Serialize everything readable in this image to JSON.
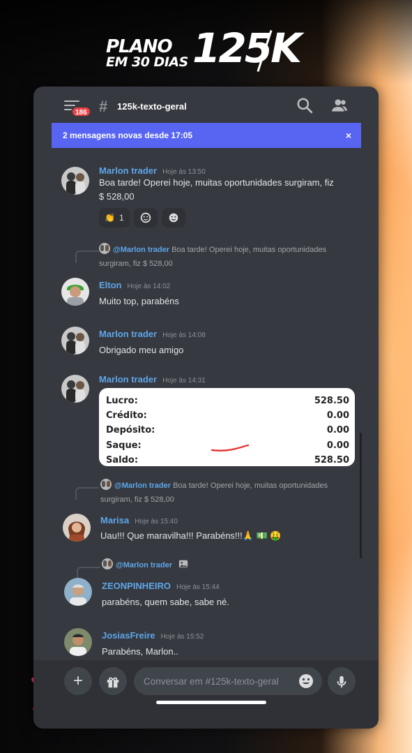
{
  "promo": {
    "line1": "PLANO",
    "line2": "EM 30 DIAS",
    "big": "125K"
  },
  "topbar": {
    "badge": "186",
    "channel_name": "125k-texto-geral",
    "icons": [
      "menu-icon",
      "search-icon",
      "members-icon"
    ]
  },
  "new_messages_bar": {
    "text": "2 mensagens novas desde 17:05",
    "close": "×"
  },
  "messages": [
    {
      "author": "Marlon trader",
      "time": "Hoje às 13:50",
      "line1": "Boa tarde! Operei hoje, muitas oportunidades surgiram, fiz",
      "line2": "$  528,00",
      "reactions": [
        {
          "emoji": "👏",
          "count": "1"
        },
        {
          "icon": "add-reaction-icon"
        },
        {
          "icon": "add-reaction-icon"
        }
      ]
    },
    {
      "reply": {
        "author": "@Marlon trader",
        "line1": "Boa tarde! Operei hoje, muitas oportunidades",
        "line2": "surgiram, fiz $  528,00"
      },
      "author": "Elton",
      "time": "Hoje às 14:02",
      "text": "Muito top, parabéns"
    },
    {
      "author": "Marlon trader",
      "time": "Hoje às 14:08",
      "text": "Obrigado meu amigo"
    },
    {
      "author": "Marlon trader",
      "time": "Hoje às 14:31",
      "card": [
        {
          "label": "Lucro:",
          "value": "528.50"
        },
        {
          "label": "Crédito:",
          "value": "0.00"
        },
        {
          "label": "Depósito:",
          "value": "0.00"
        },
        {
          "label": "Saque:",
          "value": "0.00"
        },
        {
          "label": "Saldo:",
          "value": "528.50"
        }
      ]
    },
    {
      "reply": {
        "author": "@Marlon trader",
        "line1": "Boa tarde! Operei hoje, muitas oportunidades",
        "line2": "surgiram, fiz $  528,00"
      },
      "author": "Marisa",
      "time": "Hoje às 15:40",
      "text": "Uau!!! Que maravilha!!! Parabéns!!!🙏 💵 🤑"
    },
    {
      "reply": {
        "author": "@Marlon trader",
        "icon": "image-icon"
      },
      "author": "ZEONPINHEIRO",
      "time": "Hoje às 15:44",
      "text": "parabéns, quem sabe, sabe né."
    },
    {
      "author": "JosiasFreire",
      "time": "Hoje às 15:52",
      "text": "Parabéns, Marlon.."
    }
  ],
  "composer": {
    "add": "+",
    "gift_icon": "gift-icon",
    "placeholder": "Conversar em #125k-texto-geral",
    "emoji_icon": "emoji-icon",
    "mic_icon": "microphone-icon"
  },
  "colors": {
    "blurple": "#5865f2",
    "username": "#5ea6ea",
    "badge": "#ed4245",
    "background": "#36393f"
  }
}
